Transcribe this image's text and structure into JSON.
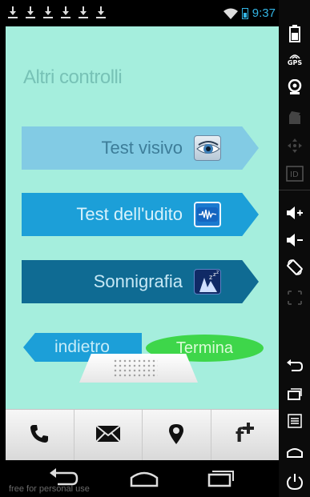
{
  "status_bar": {
    "download_icons": [
      "download-icon",
      "download-icon",
      "download-icon",
      "download-icon",
      "download-icon",
      "download-icon"
    ],
    "time": "9:37"
  },
  "page": {
    "title": "Altri controlli",
    "buttons": [
      {
        "label": "Test visivo",
        "icon": "eye-icon"
      },
      {
        "label": "Test dell'udito",
        "icon": "audio-wave-icon"
      },
      {
        "label": "Sonnigrafia",
        "icon": "sleep-icon"
      }
    ],
    "back_label": "indietro",
    "end_label": "Termina"
  },
  "action_bar": {
    "items": [
      "phone-icon",
      "mail-icon",
      "location-pin-icon",
      "facebook-add-icon"
    ],
    "fplus_text": "f"
  },
  "nav_bar": {
    "watermark": "free for personal use"
  },
  "sidebar": {
    "gps_label": "GPS",
    "id_label": "ID"
  },
  "colors": {
    "background": "#a5eedd",
    "button_light": "#82cbe4",
    "button_mid": "#1c9fd8",
    "button_dark": "#0f6b93",
    "end_button": "#3ed64a",
    "status_text": "#33b5e5"
  }
}
